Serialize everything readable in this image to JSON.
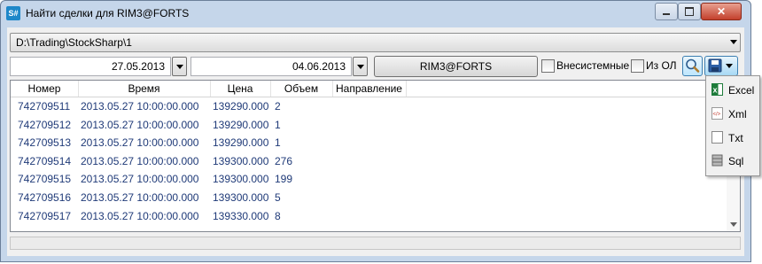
{
  "window": {
    "title": "Найти сделки для RIM3@FORTS",
    "app_icon_text": "S#",
    "close_symbol": "✕"
  },
  "path_combo": {
    "value": "D:\\Trading\\StockSharp\\1"
  },
  "filters": {
    "date_from": "27.05.2013",
    "date_to": "04.06.2013",
    "security_button": "RIM3@FORTS",
    "checkbox1_label": "Внесистемные",
    "checkbox1_checked": false,
    "checkbox2_label": "Из ОЛ",
    "checkbox2_checked": false
  },
  "grid": {
    "columns": [
      "Номер",
      "Время",
      "Цена",
      "Объем",
      "Направление"
    ],
    "rows": [
      [
        "742709511",
        "2013.05.27 10:00:00.000",
        "139290.000",
        "2",
        ""
      ],
      [
        "742709512",
        "2013.05.27 10:00:00.000",
        "139290.000",
        "1",
        ""
      ],
      [
        "742709513",
        "2013.05.27 10:00:00.000",
        "139290.000",
        "1",
        ""
      ],
      [
        "742709514",
        "2013.05.27 10:00:00.000",
        "139300.000",
        "276",
        ""
      ],
      [
        "742709515",
        "2013.05.27 10:00:00.000",
        "139300.000",
        "199",
        ""
      ],
      [
        "742709516",
        "2013.05.27 10:00:00.000",
        "139300.000",
        "5",
        ""
      ],
      [
        "742709517",
        "2013.05.27 10:00:00.000",
        "139330.000",
        "8",
        ""
      ]
    ]
  },
  "export_menu": {
    "items": [
      {
        "label": "Excel",
        "icon": "excel-icon",
        "color": "#1d7b3a"
      },
      {
        "label": "Xml",
        "icon": "xml-icon",
        "color": "#c0392b"
      },
      {
        "label": "Txt",
        "icon": "txt-icon",
        "color": "#888888"
      },
      {
        "label": "Sql",
        "icon": "sql-icon",
        "color": "#666666"
      }
    ]
  },
  "colors": {
    "title_bar": "#c5d6ea",
    "row_text": "#1f3a78",
    "accent": "#3c7fb1"
  }
}
